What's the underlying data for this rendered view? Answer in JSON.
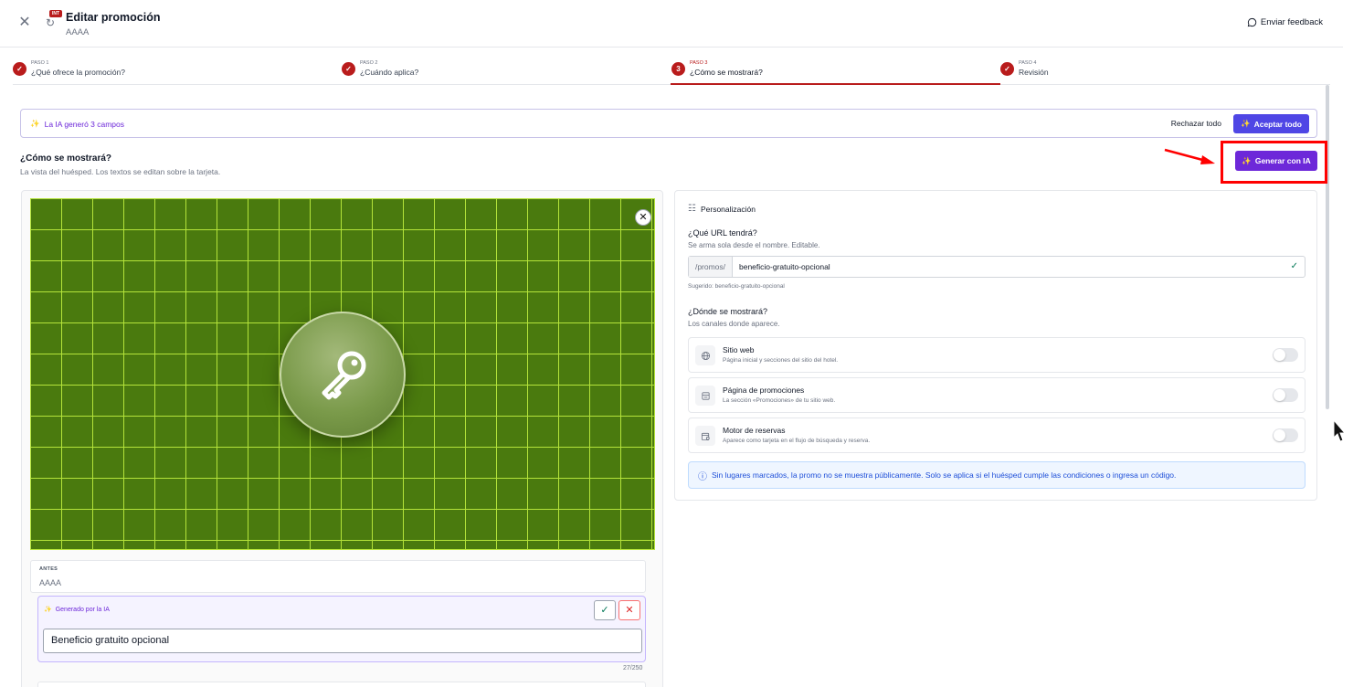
{
  "header": {
    "close_icon": "close-icon",
    "badge": "INT",
    "title": "Editar promoción",
    "subtitle": "AAAA",
    "feedback": "Enviar feedback"
  },
  "stepper": {
    "steps": [
      {
        "small": "PASO 1",
        "label": "¿Qué ofrece la promoción?",
        "state": "done"
      },
      {
        "small": "PASO 2",
        "label": "¿Cuándo aplica?",
        "state": "done"
      },
      {
        "small": "PASO 3",
        "label": "¿Cómo se mostrará?",
        "state": "active",
        "number": "3"
      },
      {
        "small": "PASO 4",
        "label": "Revisión",
        "state": "done"
      }
    ]
  },
  "ai_bar": {
    "message": "La IA generó 3 campos",
    "reject": "Rechazar todo",
    "accept": "Aceptar todo"
  },
  "section": {
    "title": "¿Cómo se mostrará?",
    "subtitle": "La vista del huésped. Los textos se editan sobre la tarjeta.",
    "generate": "Generar con IA"
  },
  "preview": {
    "before_label": "ANTES",
    "before_value": "AAAA",
    "ai_label": "Generado por la IA",
    "ai_value": "Beneficio gratuito opcional",
    "counter": "27/250",
    "image_icon": "key-icon"
  },
  "panel": {
    "title": "Personalización",
    "url_question": "¿Qué URL tendrá?",
    "url_help": "Se arma sola desde el nombre. Editable.",
    "url_prefix": "/promos/",
    "url_value": "beneficio-gratuito-opcional",
    "url_hint": "Sugerido: beneficio-gratuito-opcional",
    "where_question": "¿Dónde se mostrará?",
    "where_help": "Los canales donde aparece.",
    "channels": [
      {
        "name": "Sitio web",
        "desc": "Página inicial y secciones del sitio del hotel.",
        "icon": "globe-icon",
        "enabled": false
      },
      {
        "name": "Página de promociones",
        "desc": "La sección «Promociones» de tu sitio web.",
        "icon": "layout-icon",
        "enabled": false
      },
      {
        "name": "Motor de reservas",
        "desc": "Aparece como tarjeta en el flujo de búsqueda y reserva.",
        "icon": "calendar-search-icon",
        "enabled": false
      }
    ],
    "info": "Sin lugares marcados, la promo no se muestra públicamente. Solo se aplica si el huésped cumple las condiciones o ingresa un código."
  },
  "colors": {
    "brand_red": "#b91c1c",
    "ai_purple": "#6d28d9",
    "accept_blue": "#4f46e5",
    "grid_green": "#4a7a0e"
  }
}
